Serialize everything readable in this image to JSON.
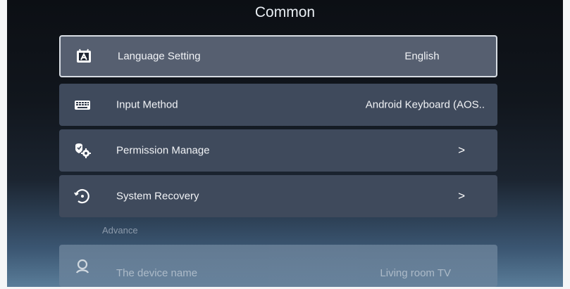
{
  "page": {
    "title": "Common"
  },
  "menu": {
    "items": [
      {
        "label": "Language Setting",
        "value": "English",
        "icon": "language-icon",
        "focused": true
      },
      {
        "label": "Input Method",
        "value": "Android Keyboard (AOS..",
        "icon": "keyboard-icon"
      },
      {
        "label": "Permission Manage",
        "value": ">",
        "icon": "permission-gear-icon"
      },
      {
        "label": "System Recovery",
        "value": ">",
        "icon": "recovery-icon"
      }
    ]
  },
  "advance": {
    "section_label": "Advance",
    "items": [
      {
        "label": "The device name",
        "value": "Living room TV",
        "icon": "device-name-icon"
      }
    ]
  }
}
